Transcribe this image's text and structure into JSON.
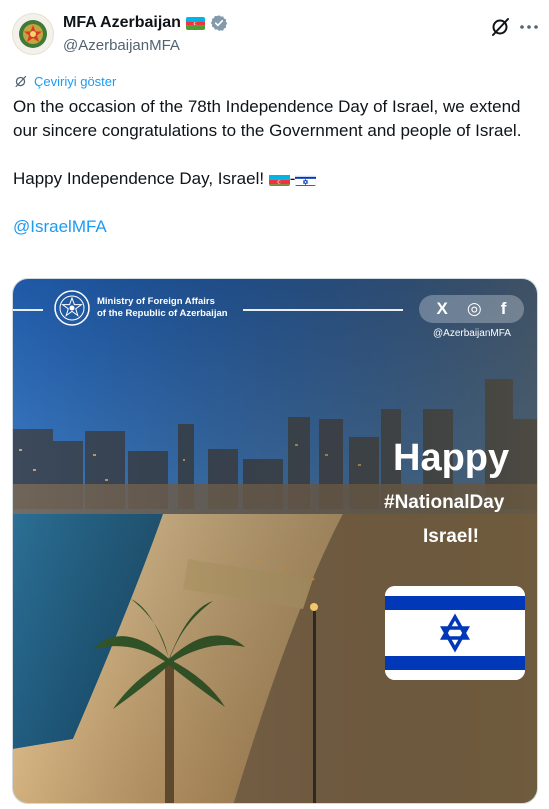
{
  "account": {
    "display_name": "MFA Azerbaijan",
    "handle": "@AzerbaijanMFA",
    "avatar_icon": "azerbaijan-emblem",
    "badge_icon": "verified-gray-badge",
    "flag_icon": "azerbaijan-flag"
  },
  "actions": {
    "grok_icon": "grok-icon",
    "more_icon": "more-dots-icon"
  },
  "translate": {
    "label": "Çeviriyi göster",
    "icon": "translate-icon"
  },
  "tweet": {
    "paragraph1": "On the occasion of the 78th Independence Day of Israel, we extend our sincere congratulations to the Government and people of Israel.",
    "paragraph2_text": "Happy Independence Day, Israel! ",
    "separator": "-",
    "mention": "@IsraelMFA"
  },
  "media": {
    "ministry_line1": "Ministry of Foreign Affairs",
    "ministry_line2": "of the Republic of Azerbaijan",
    "social_icons": [
      "x-icon",
      "instagram-icon",
      "facebook-icon"
    ],
    "social_x": "X",
    "social_ig": "◎",
    "social_fb": "f",
    "social_handle": "@AzerbaijanMFA",
    "headline": "Happy",
    "hashtag": "#NationalDay",
    "country": "Israel!"
  },
  "colors": {
    "accent": "#1d9bf0",
    "text": "#0f1419",
    "secondary": "#536471",
    "israel_blue": "#0038b8",
    "az_blue": "#00b5e2",
    "az_red": "#ef3340",
    "az_green": "#509e2f"
  }
}
